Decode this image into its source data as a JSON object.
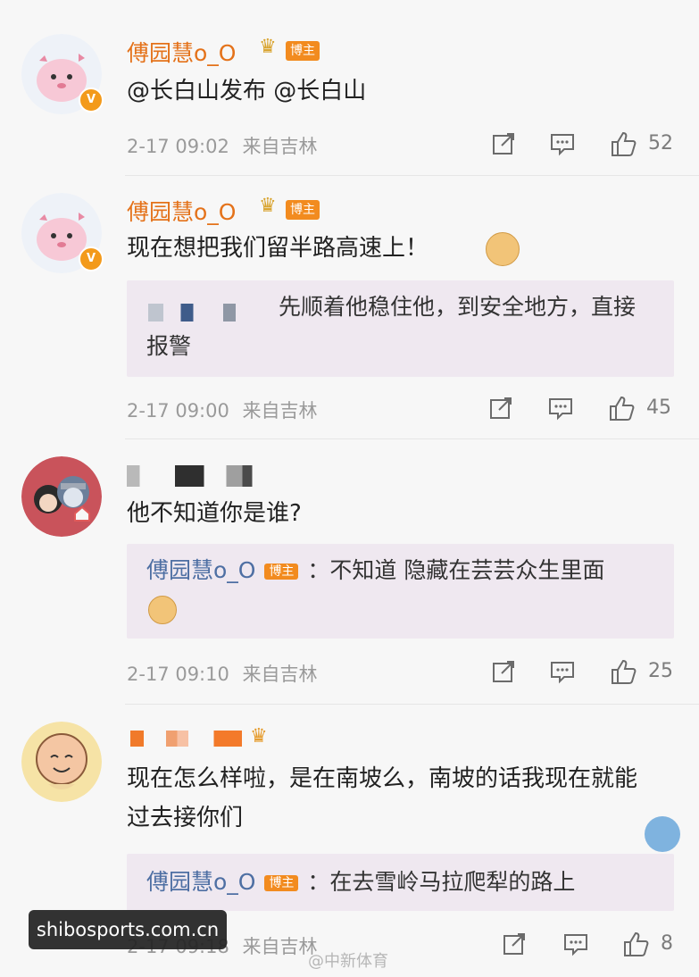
{
  "comments": [
    {
      "author": "傅园慧o_O",
      "tag": "博主",
      "text": "@长白山发布 @长白山",
      "time": "2-17 09:02",
      "source": "来自吉林",
      "likes": "52"
    },
    {
      "author": "傅园慧o_O",
      "tag": "博主",
      "text": "现在想把我们留半路高速上！",
      "quote": "先顺着他稳住他，到安全地方，直接报警",
      "time": "2-17 09:00",
      "source": "来自吉林",
      "likes": "45"
    },
    {
      "text": "他不知道你是谁?",
      "quote_author": "傅园慧o_O",
      "quote_tag": "博主",
      "quote": "：不知道 隐藏在芸芸众生里面",
      "time": "2-17 09:10",
      "source": "来自吉林",
      "likes": "25"
    },
    {
      "text": "现在怎么样啦，是在南坡么，南坡的话我现在就能过去接你们",
      "quote_author": "傅园慧o_O",
      "quote_tag": "博主",
      "quote": "：在去雪岭马拉爬犁的路上",
      "time": "2-17 09:18",
      "source": "来自吉林",
      "likes": "8"
    }
  ],
  "watermark": "shibosports.com.cn",
  "credit": "@中新体育",
  "icons": {
    "share": "share-icon",
    "comment": "comment-icon",
    "like": "thumbs-up-icon",
    "verified": "verified-badge-icon",
    "crown": "crown-icon"
  },
  "colors": {
    "author": "#e4721a",
    "tag_bg": "#f28b1f",
    "quote_bg": "#efe8f0",
    "quote_author": "#4e6fa3",
    "meta": "#9a9a9a"
  }
}
